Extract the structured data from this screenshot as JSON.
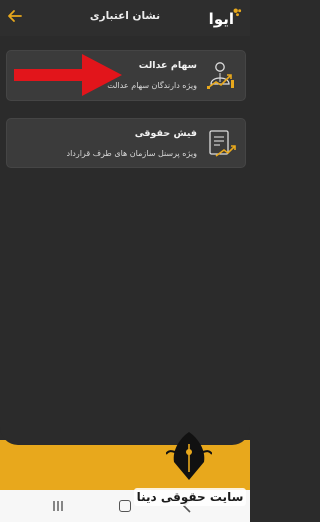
{
  "header": {
    "brand": "ایوا",
    "title": "نشان اعتباری"
  },
  "cards": [
    {
      "title": "سهام عدالت",
      "subtitle": "ویژه دارندگان سهام عدالت",
      "icon": "justice-shares-icon"
    },
    {
      "title": "فیش حقوقی",
      "subtitle": "ویژه پرسنل سازمان های طرف قرارداد",
      "icon": "payslip-icon"
    }
  ],
  "watermark": {
    "text": "سایت حقوقی دینا"
  },
  "colors": {
    "accent": "#e8a81c",
    "background": "#2b2b2b",
    "card": "#3b3b3b",
    "arrow": "#e2151b"
  }
}
